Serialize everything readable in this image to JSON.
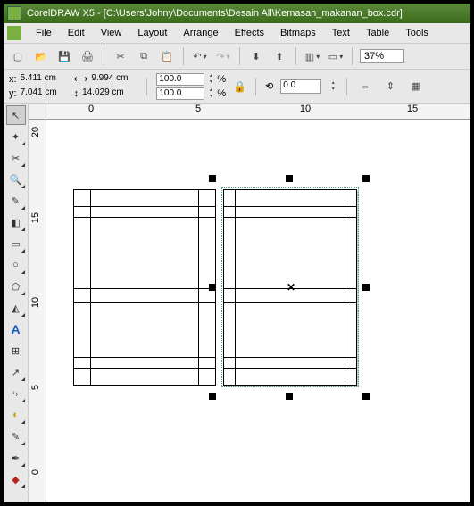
{
  "title": "CorelDRAW X5 - [C:\\Users\\Johny\\Documents\\Desain All\\Kemasan_makanan_box.cdr]",
  "menu": {
    "file": "File",
    "edit": "Edit",
    "view": "View",
    "layout": "Layout",
    "arrange": "Arrange",
    "effects": "Effects",
    "bitmaps": "Bitmaps",
    "text": "Text",
    "table": "Table",
    "tools": "Tools"
  },
  "toolbar": {
    "zoom": "37%"
  },
  "prop": {
    "x_label": "x:",
    "y_label": "y:",
    "x": "5.411 cm",
    "y": "7.041 cm",
    "w": "9.994 cm",
    "h": "14.029 cm",
    "scale_x": "100.0",
    "scale_y": "100.0",
    "pct": "%",
    "angle": "0.0"
  },
  "ruler_h": [
    "0",
    "5",
    "10",
    "15"
  ],
  "ruler_v": [
    "20",
    "15",
    "10",
    "5",
    "0"
  ]
}
